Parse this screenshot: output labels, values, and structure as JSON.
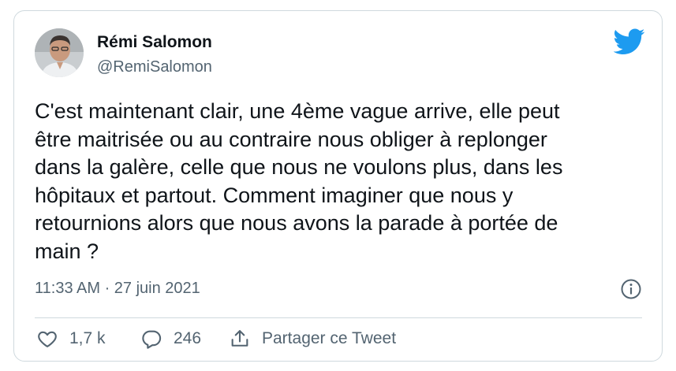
{
  "colors": {
    "brand_blue": "#1d9bf0",
    "text_primary": "#0f1419",
    "text_secondary": "#536471",
    "border": "#cfd9de"
  },
  "author": {
    "name": "Rémi Salomon",
    "handle": "@RemiSalomon",
    "avatar_icon": "person-avatar"
  },
  "brand_icon": "twitter-bird-icon",
  "tweet": {
    "text": "C'est maintenant clair, une 4ème vague arrive, elle peut\nêtre maitrisée ou au contraire nous obliger à replonger\ndans la galère, celle que nous ne voulons plus, dans les\nhôpitaux et partout. Comment imaginer que nous y\nretournions alors que nous avons la parade à portée de\nmain ?",
    "timestamp": "11:33 AM · 27 juin 2021",
    "info_icon": "info-icon"
  },
  "actions": {
    "like": {
      "icon": "heart-icon",
      "label": "1,7 k"
    },
    "reply": {
      "icon": "comment-icon",
      "label": "246"
    },
    "share": {
      "icon": "share-icon",
      "label": "Partager ce Tweet"
    }
  }
}
